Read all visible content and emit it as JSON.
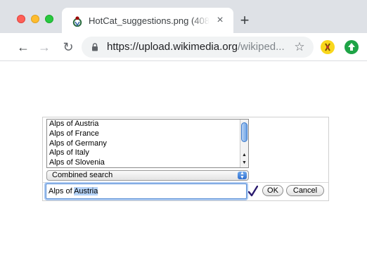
{
  "tab": {
    "title": "HotCat_suggestions.png (408",
    "close_glyph": "×",
    "new_tab_glyph": "+"
  },
  "toolbar": {
    "back_glyph": "←",
    "forward_glyph": "→",
    "reload_glyph": "↻",
    "url_main": "https://upload.wikimedia.org",
    "url_rest": "/wikiped...",
    "star_glyph": "☆"
  },
  "widget": {
    "suggestions": [
      "Alps of Austria",
      "Alps of France",
      "Alps of Germany",
      "Alps of Italy",
      "Alps of Slovenia"
    ],
    "scroll_up_glyph": "▲",
    "scroll_down_glyph": "▼",
    "search_mode": "Combined search",
    "input_prefix": "Alps of ",
    "input_selected": "Austria",
    "ok_label": "OK",
    "cancel_label": "Cancel"
  },
  "colors": {
    "tabstrip": "#dee1e6",
    "accent_blue": "#3a78c9",
    "check_purple": "#2a1a6e"
  }
}
